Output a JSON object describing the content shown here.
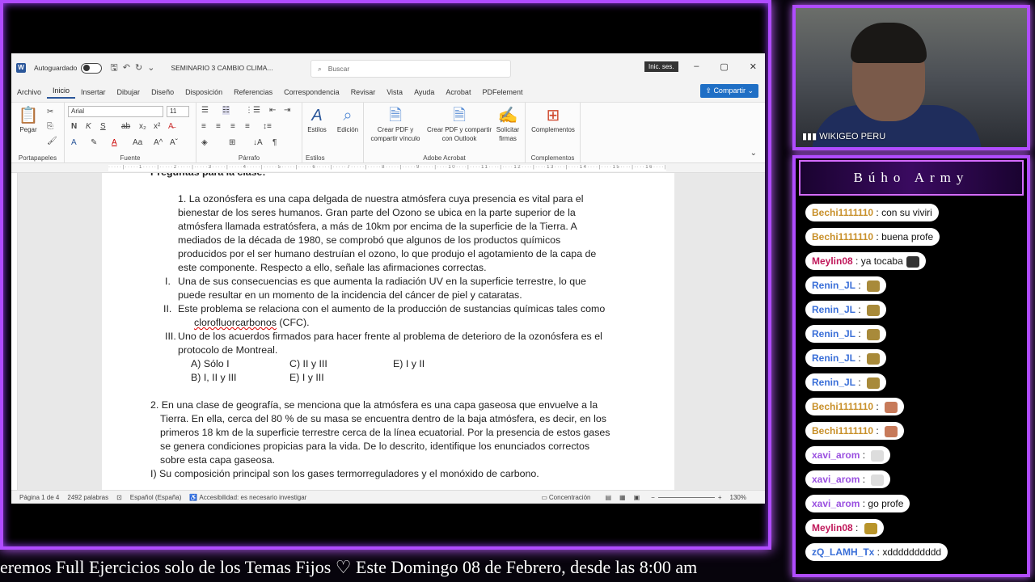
{
  "word": {
    "autosave_label": "Autoguardado",
    "doc_title": "SEMINARIO 3 CAMBIO CLIMA...",
    "search_placeholder": "Buscar",
    "signin": "Inic. ses.",
    "menu": [
      "Archivo",
      "Inicio",
      "Insertar",
      "Dibujar",
      "Diseño",
      "Disposición",
      "Referencias",
      "Correspondencia",
      "Revisar",
      "Vista",
      "Ayuda",
      "Acrobat",
      "PDFelement"
    ],
    "share": "Compartir",
    "font_name": "Arial",
    "font_size": "11",
    "groups": {
      "clipboard": "Portapapeles",
      "font": "Fuente",
      "paragraph": "Párrafo",
      "styles": "Estilos",
      "acrobat": "Adobe Acrobat",
      "addins": "Complementos"
    },
    "paste": "Pegar",
    "styles_btn": "Estilos",
    "edit_btn": "Edición",
    "pdf1": [
      "Crear PDF y",
      "compartir vínculo"
    ],
    "pdf2": [
      "Crear PDF y compartir",
      "con Outlook"
    ],
    "sign": [
      "Solicitar",
      "firmas"
    ],
    "addins_btn": "Complementos",
    "status": {
      "page": "Página 1 de 4",
      "words": "2492 palabras",
      "lang": "Español (España)",
      "access": "Accesibilidad: es necesario investigar",
      "focus": "Concentración",
      "zoom": "130%"
    }
  },
  "document": {
    "heading": "Preguntas para la clase:",
    "lines": [
      "1.  La ozonósfera es una capa delgada de nuestra atmósfera cuya presencia es vital para el",
      "bienestar de los seres humanos. Gran parte del Ozono se ubica en la parte superior de la",
      "atmósfera llamada estratósfera, a más de 10km por encima de la superficie de la Tierra. A",
      "mediados de la década de 1980, se comprobó que algunos de los productos químicos",
      "producidos por el ser humano destruían el ozono, lo que produjo el agotamiento de la capa de",
      "este componente. Respecto a ello, señale las afirmaciones correctas."
    ],
    "items": [
      {
        "num": "I.",
        "l1": "Una de sus consecuencias es que aumenta la radiación UV en la superficie terrestre, lo que",
        "l2": "puede resultar en un momento de la incidencia del cáncer de piel y cataratas."
      },
      {
        "num": "II.",
        "l1": "Este problema se relaciona con el aumento de la producción de sustancias químicas tales como",
        "l2a": "clorofluorcarbonos",
        "l2b": " (CFC)."
      },
      {
        "num": "III.",
        "l1": "Uno de los acuerdos firmados para hacer frente al problema de deterioro de la ozonósfera es el",
        "l2": "protocolo de Montreal."
      }
    ],
    "options": {
      "a": "A)   Sólo I",
      "c": "C) II y III",
      "e1": "E) I y II",
      "b": "B)   I, II y III",
      "e2": "E) I y III"
    },
    "q2": [
      "2. En una clase de geografía, se menciona que la atmósfera es una capa gaseosa que envuelve a la",
      "Tierra. En ella, cerca del 80 % de su masa se encuentra dentro de la baja atmósfera, es decir, en los",
      "primeros 18 km de la superficie terrestre cerca de la línea ecuatorial. Por la presencia de estos gases",
      "se genera condiciones propicias para la vida. De lo descrito, identifique los enunciados correctos",
      "sobre esta capa gaseosa.",
      "I) Su composición principal son los gases termorreguladores y el monóxido de carbono."
    ]
  },
  "ticker": "eremos Full Ejercicios solo de los Temas Fijos ♡  Este Domingo 08 de Febrero, desde las 8:00 am",
  "cam_label": "WIKIGEO PERU",
  "chat_title": "Búho Army",
  "chat": [
    {
      "user": "Bechi1111110",
      "text": "con su viviri",
      "color": "#c8902a",
      "emoji": ""
    },
    {
      "user": "Bechi1111110",
      "text": "buena profe",
      "color": "#c8902a",
      "emoji": ""
    },
    {
      "user": "Meylin08",
      "text": "ya tocaba",
      "color": "#c0185a",
      "emoji": "cat"
    },
    {
      "user": "Renin_JL",
      "text": "",
      "color": "#3a6fd8",
      "emoji": "img"
    },
    {
      "user": "Renin_JL",
      "text": "",
      "color": "#3a6fd8",
      "emoji": "img"
    },
    {
      "user": "Renin_JL",
      "text": "",
      "color": "#3a6fd8",
      "emoji": "img"
    },
    {
      "user": "Renin_JL",
      "text": "",
      "color": "#3a6fd8",
      "emoji": "img"
    },
    {
      "user": "Renin_JL",
      "text": "",
      "color": "#3a6fd8",
      "emoji": "img"
    },
    {
      "user": "Bechi1111110",
      "text": "",
      "color": "#c8902a",
      "emoji": "face"
    },
    {
      "user": "Bechi1111110",
      "text": "",
      "color": "#c8902a",
      "emoji": "face"
    },
    {
      "user": "xavi_arom",
      "text": "",
      "color": "#9a50e0",
      "emoji": "hand"
    },
    {
      "user": "xavi_arom",
      "text": "",
      "color": "#9a50e0",
      "emoji": "hand"
    },
    {
      "user": "xavi_arom",
      "text": "go profe",
      "color": "#9a50e0",
      "emoji": ""
    },
    {
      "user": "Meylin08",
      "text": "",
      "color": "#c0185a",
      "emoji": "gold"
    },
    {
      "user": "zQ_LAMH_Tx",
      "text": "xdddddddddd",
      "color": "#3a6fd8",
      "emoji": ""
    }
  ]
}
